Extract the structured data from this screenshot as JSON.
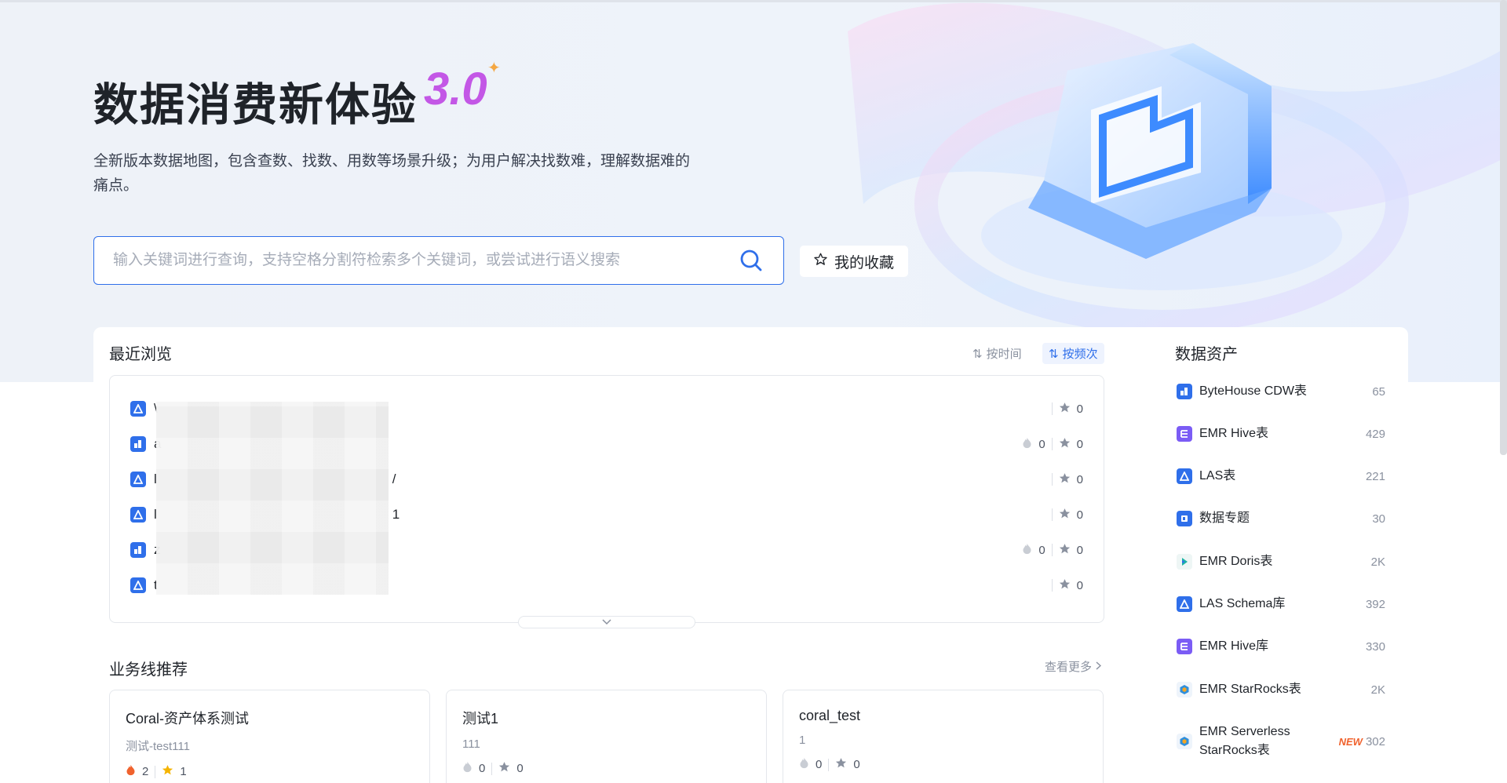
{
  "hero": {
    "title": "数据消费新体验",
    "version": "3.0",
    "subtitle": "全新版本数据地图，包含查数、找数、用数等场景升级；为用户解决找数难，理解数据难的痛点。",
    "search_placeholder": "输入关键词进行查询，支持空格分割符检索多个关键词，或尝试进行语义搜索",
    "favorites_label": "我的收藏"
  },
  "recent": {
    "title": "最近浏览",
    "sort_time": "按时间",
    "sort_freq": "按频次",
    "rows": [
      {
        "name": "\\",
        "hot": "",
        "stars": "0",
        "icon": "las-icon"
      },
      {
        "name": "a",
        "hot": "0",
        "stars": "0",
        "icon": "bytehouse-icon"
      },
      {
        "name": "l",
        "hot": "",
        "stars": "0",
        "icon": "las-icon",
        "tail": "/"
      },
      {
        "name": "l",
        "hot": "",
        "stars": "0",
        "icon": "las-icon",
        "tail": "1"
      },
      {
        "name": "z",
        "hot": "0",
        "stars": "0",
        "icon": "bytehouse-icon"
      },
      {
        "name": "t",
        "hot": "",
        "stars": "0",
        "icon": "las-icon"
      }
    ]
  },
  "business": {
    "title": "业务线推荐",
    "more": "查看更多",
    "cards": [
      {
        "title": "Coral-资产体系测试",
        "subtitle": "测试-test111",
        "hot": "2",
        "stars": "1"
      },
      {
        "title": "测试1",
        "subtitle": "111",
        "hot": "0",
        "stars": "0"
      },
      {
        "title": "coral_test",
        "subtitle": "1",
        "hot": "0",
        "stars": "0"
      }
    ]
  },
  "assets": {
    "title": "数据资产",
    "items": [
      {
        "name": "ByteHouse CDW表",
        "count": "65",
        "icon": "bytehouse-icon",
        "color": "#2f6fea"
      },
      {
        "name": "EMR Hive表",
        "count": "429",
        "icon": "emr-hive-icon",
        "color": "#7b5cf5"
      },
      {
        "name": "LAS表",
        "count": "221",
        "icon": "las-icon",
        "color": "#2f6fea"
      },
      {
        "name": "数据专题",
        "count": "30",
        "icon": "topic-icon",
        "color": "#2f6fea"
      },
      {
        "name": "EMR Doris表",
        "count": "2K",
        "icon": "doris-icon",
        "color": "#1bb3a4"
      },
      {
        "name": "LAS Schema库",
        "count": "392",
        "icon": "las-icon",
        "color": "#2f6fea"
      },
      {
        "name": "EMR Hive库",
        "count": "330",
        "icon": "emr-hive-icon",
        "color": "#7b5cf5"
      },
      {
        "name": "EMR StarRocks表",
        "count": "2K",
        "icon": "starrocks-icon",
        "color": "#f5a623"
      },
      {
        "name": "EMR Serverless StarRocks表",
        "count": "302",
        "icon": "starrocks-icon",
        "color": "#f5a623",
        "tag": "NEW"
      }
    ]
  }
}
